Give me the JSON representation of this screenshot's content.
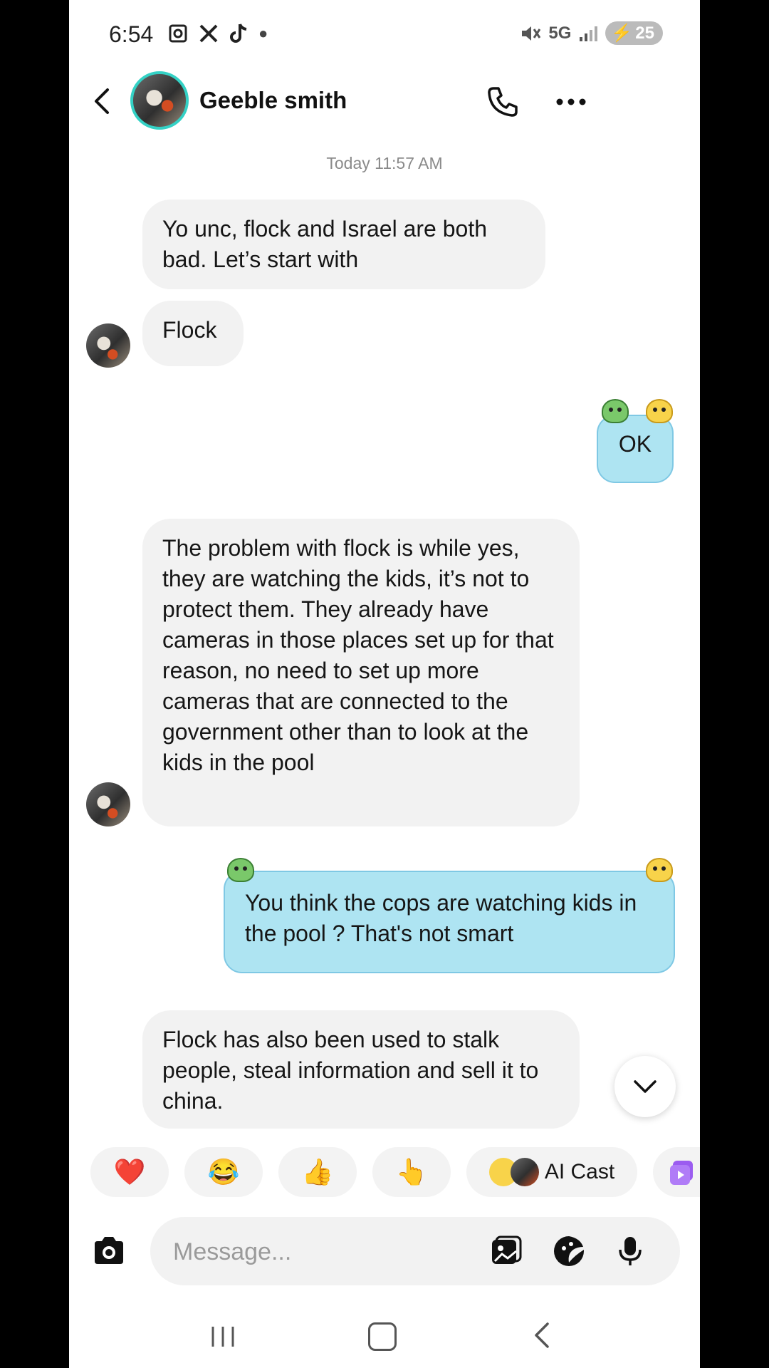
{
  "status_bar": {
    "time": "6:54",
    "network": "5G",
    "battery": "25"
  },
  "header": {
    "contact_name": "Geeble smith"
  },
  "conversation": {
    "timestamp": "Today 11:57 AM",
    "messages": [
      {
        "side": "in",
        "text": "Yo unc, flock and Israel are both bad. Let’s start with"
      },
      {
        "side": "in",
        "text": "Flock"
      },
      {
        "side": "out",
        "text": "OK"
      },
      {
        "side": "in",
        "text": "The problem with flock is while yes, they are watching the kids, it’s not to protect them. They already have cameras in those places set up for that reason, no need to set up more cameras that are connected to the government other than to look at the kids in the pool"
      },
      {
        "side": "out",
        "text": "You think the cops are watching kids in the pool ? That's not smart"
      },
      {
        "side": "in",
        "text": "Flock has also been used to stalk people, steal information and sell it to china."
      }
    ]
  },
  "quick_replies": {
    "heart": "❤️",
    "laugh": "😂",
    "thumbs_up": "👍",
    "point": "👆",
    "ai_cast_label": "AI Cast"
  },
  "composer": {
    "placeholder": "Message...",
    "value": ""
  },
  "colors": {
    "outgoing_bubble": "#aee4f2",
    "incoming_bubble": "#f2f2f2",
    "avatar_ring": "#34d1c5"
  }
}
